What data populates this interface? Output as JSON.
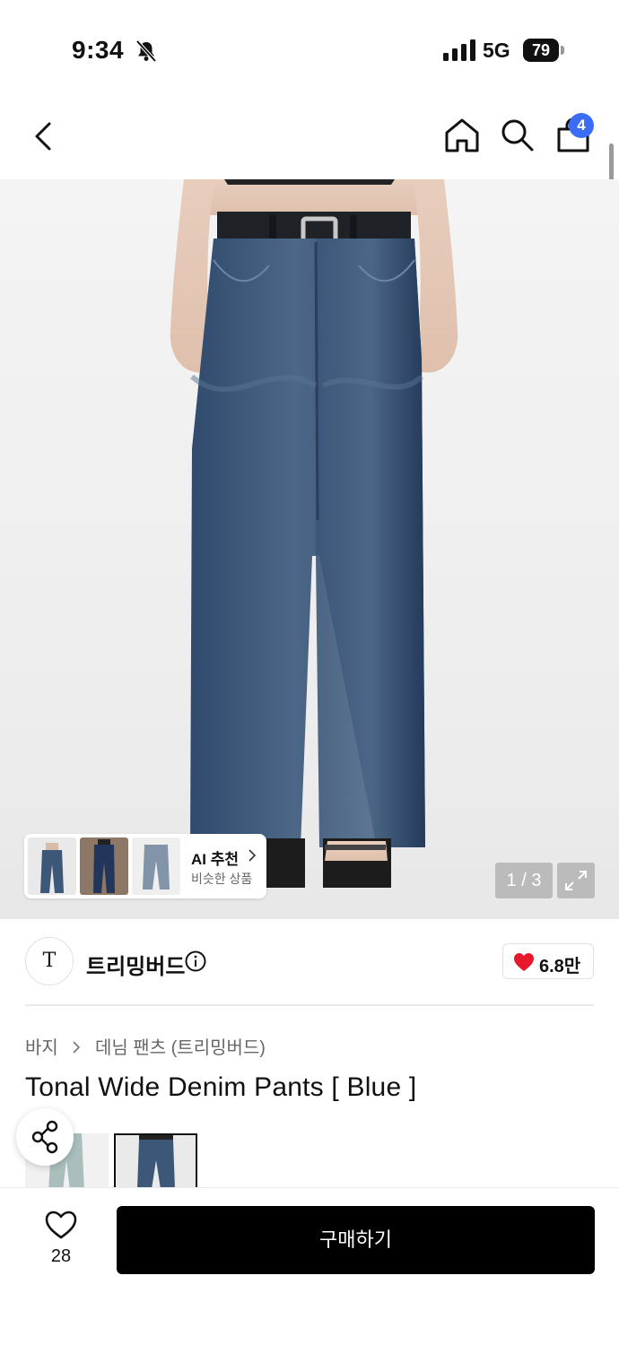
{
  "status_bar": {
    "time": "9:34",
    "network": "5G",
    "battery": "79"
  },
  "nav": {
    "cart_count": "4"
  },
  "gallery": {
    "page_indicator": "1 / 3",
    "ai_reco": {
      "title": "AI 추천",
      "subtitle": "비슷한 상품"
    }
  },
  "brand": {
    "logo_text": "T",
    "name": "트리밍버드",
    "likes": "6.8만"
  },
  "product": {
    "breadcrumb": [
      "바지",
      "데님 팬츠 (트리밍버드)"
    ],
    "title": "Tonal Wide Denim Pants [ Blue ]",
    "variants_selected_index": 1
  },
  "bottom": {
    "wish_count": "28",
    "buy_label": "구매하기"
  },
  "colors": {
    "accent_badge": "#3b6cf6",
    "heart": "#e8182c",
    "denim": "#3c5777",
    "buy_bg": "#000000"
  },
  "icons": [
    "bell-off-icon",
    "signal-icon",
    "battery-icon",
    "back-icon",
    "home-icon",
    "search-icon",
    "cart-icon",
    "chevron-right-icon",
    "expand-icon",
    "info-icon",
    "heart-icon",
    "share-icon"
  ]
}
